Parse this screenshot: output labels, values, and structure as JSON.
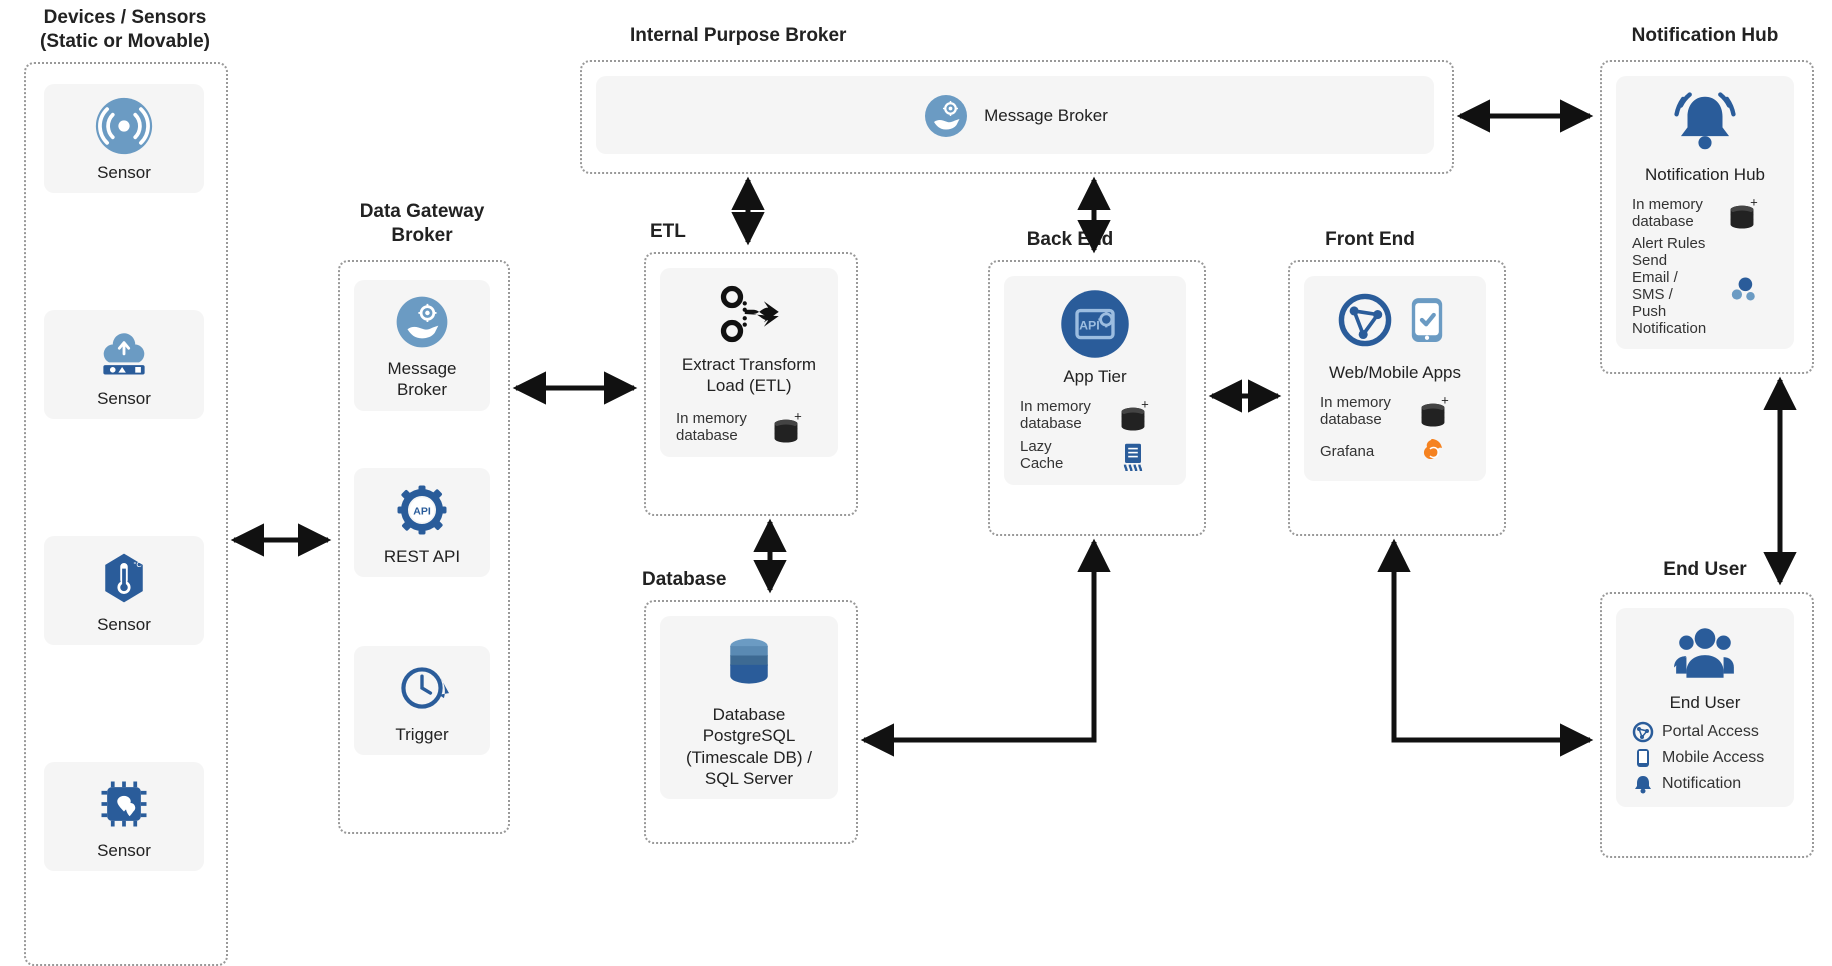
{
  "groups": {
    "devices": {
      "title": "Devices / Sensors\n(Static or Movable)"
    },
    "gateway": {
      "title": "Data Gateway\nBroker"
    },
    "internal_broker": {
      "title": "Internal Purpose Broker"
    },
    "etl": {
      "title": "ETL"
    },
    "database": {
      "title": "Database"
    },
    "backend": {
      "title": "Back End"
    },
    "frontend": {
      "title": "Front End"
    },
    "notification": {
      "title": "Notification Hub"
    },
    "enduser": {
      "title": "End User"
    }
  },
  "cards": {
    "sensor1": {
      "label": "Sensor"
    },
    "sensor2": {
      "label": "Sensor"
    },
    "sensor3": {
      "label": "Sensor"
    },
    "sensor4": {
      "label": "Sensor"
    },
    "msg_broker_gw": {
      "label": "Message\nBroker"
    },
    "rest_api": {
      "label": "REST API"
    },
    "trigger": {
      "label": "Trigger"
    },
    "msg_broker_ip": {
      "label": "Message Broker"
    },
    "etl_card": {
      "label": "Extract Transform\nLoad (ETL)",
      "sub": {
        "in_mem": "In memory\ndatabase"
      }
    },
    "db_card": {
      "label": "Database\nPostgreSQL\n(Timescale DB) /\nSQL Server"
    },
    "app_tier": {
      "label": "App Tier",
      "sub": {
        "in_mem": "In memory\ndatabase",
        "lazy_cache": "Lazy Cache"
      }
    },
    "web_mobile": {
      "label": "Web/Mobile Apps",
      "sub": {
        "in_mem": "In memory\ndatabase",
        "grafana": "Grafana"
      }
    },
    "notif_hub": {
      "label": "Notification Hub",
      "sub": {
        "in_mem": "In memory\ndatabase",
        "alert": "Alert Rules\nSend Email /\nSMS / Push Notification"
      }
    },
    "end_user": {
      "label": "End User",
      "features": {
        "portal": "Portal Access",
        "mobile": "Mobile Access",
        "notif": "Notification"
      }
    }
  }
}
